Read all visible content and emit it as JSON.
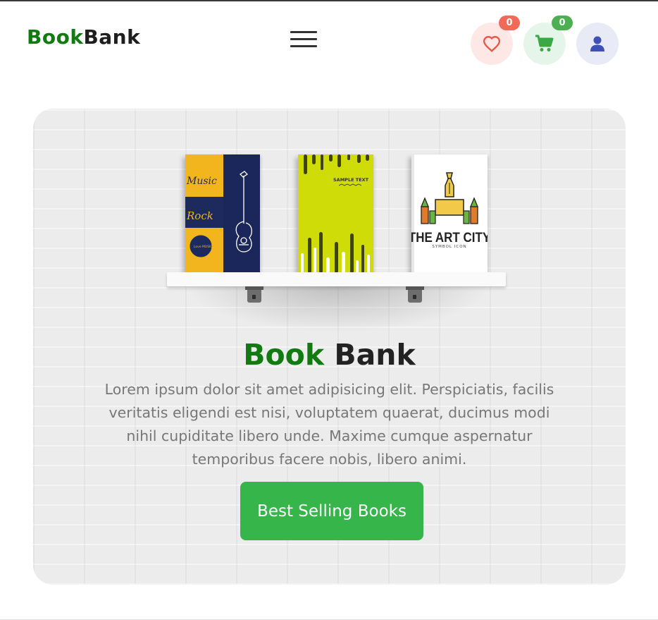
{
  "header": {
    "logo_part1": "Book",
    "logo_part2": "Bank",
    "menu_icon": "hamburger-icon",
    "wishlist_count": "0",
    "cart_count": "0",
    "icons": [
      "heart-icon",
      "cart-icon",
      "user-icon"
    ]
  },
  "hero": {
    "title_part1": "Book",
    "title_part2": "Bank",
    "description": "Lorem ipsum dolor sit amet adipisicing elit. Perspiciatis, facilis veritatis eligendi est nisi, voluptatem quaerat, ducimus modi nihil cupiditate libero unde. Maxime cumque aspernatur temporibus facere nobis, libero animi.",
    "cta_label": "Best Selling Books",
    "books": [
      {
        "cover_text": [
          "Music",
          "Rock",
          "Love MUSIC"
        ]
      },
      {
        "cover_text": [
          "SAMPLE TEXT"
        ]
      },
      {
        "cover_text": [
          "THE ART CITY",
          "SYMBOL ICON"
        ]
      }
    ]
  },
  "colors": {
    "brand_green": "#117a11",
    "button_green": "#35b54a",
    "wishlist_badge": "#f06a5a",
    "cart_badge": "#4caf50",
    "user_icon": "#3f51b5"
  }
}
